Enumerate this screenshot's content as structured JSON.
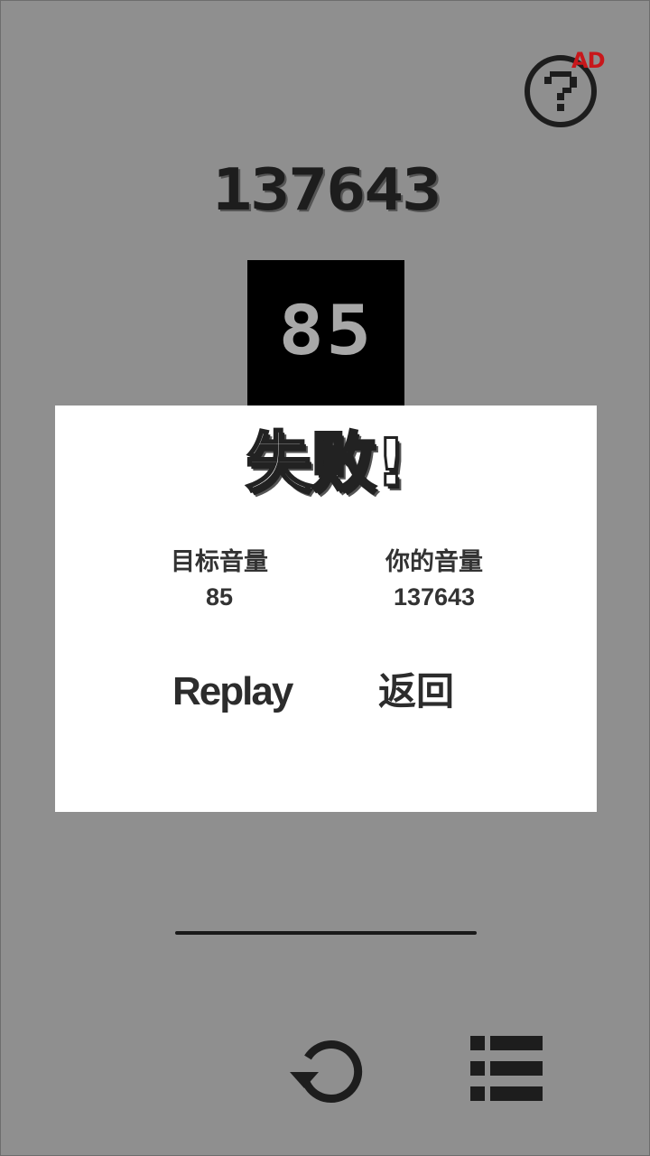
{
  "help": {
    "icon": "question-mark-icon",
    "badge": "AD"
  },
  "score": {
    "current": "137643",
    "target": "85"
  },
  "dialog": {
    "title": "失败!",
    "target_label": "目标音量",
    "target_value": "85",
    "yours_label": "你的音量",
    "yours_value": "137643",
    "replay_label": "Replay",
    "back_label": "返回"
  },
  "controls": {
    "restart_icon": "restart-icon",
    "menu_icon": "menu-list-icon"
  },
  "colors": {
    "background": "#8f8f8f",
    "panel": "#ffffff",
    "ink": "#1d1d1d",
    "badge": "#c8171b",
    "target_box": "#000000",
    "target_text": "#a8a8a8"
  }
}
